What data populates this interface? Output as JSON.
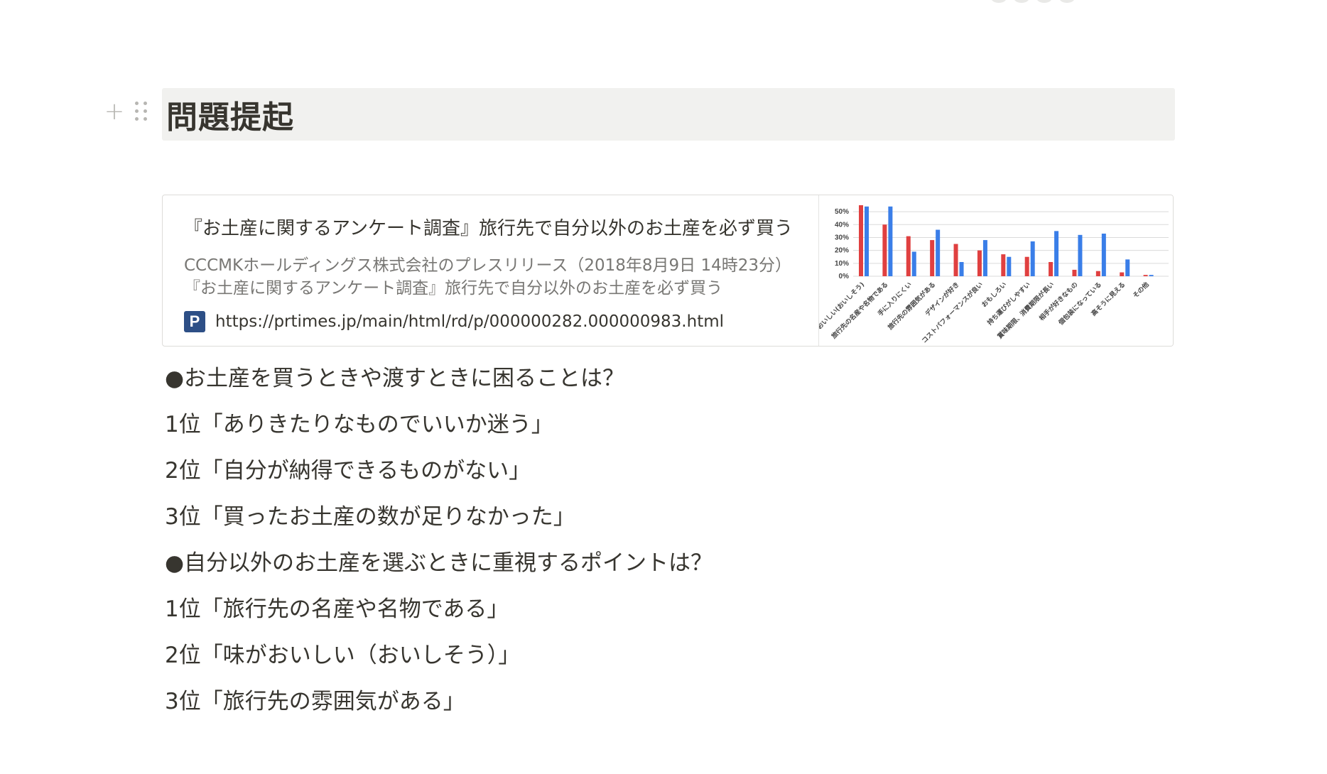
{
  "heading": {
    "text": "問題提起"
  },
  "bookmark": {
    "title": "『お土産に関するアンケート調査』旅行先で自分以外のお土産を必ず買う",
    "description": "CCCMKホールディングス株式会社のプレスリリース（2018年8月9日 14時23分）『お土産に関するアンケート調査』旅行先で自分以外のお土産を必ず買う",
    "url": "https://prtimes.jp/main/html/rd/p/000000282.000000983.html",
    "favicon_letter": "P",
    "favicon_icon": "prtimes-logo-icon"
  },
  "chart_data": {
    "type": "bar",
    "yticks": [
      "50%",
      "40%",
      "30%",
      "20%",
      "10%",
      "0%"
    ],
    "ylim": [
      0,
      55
    ],
    "categories": [
      "味がおいしい(おいしそう)",
      "旅行先の名産や名物である",
      "手に入りにくい",
      "旅行先の雰囲気がある",
      "デザインが好き",
      "コストパフォーマンスが良い",
      "おもしろい",
      "持ち運びがしやすい",
      "賞味期限、消費期限が長い",
      "相手が好きなもの",
      "個包装になっている",
      "高そうに見える",
      "その他"
    ],
    "series": [
      {
        "color": "#e04040",
        "values": [
          55,
          40,
          31,
          28,
          25,
          20,
          17,
          15,
          11,
          5,
          4,
          3,
          1
        ]
      },
      {
        "color": "#3a7ee8",
        "values": [
          54,
          54,
          19,
          36,
          11,
          28,
          15,
          27,
          35,
          32,
          33,
          13,
          1
        ]
      }
    ]
  },
  "content": {
    "lines": [
      "●お土産を買うときや渡すときに困ることは？",
      "1位「ありきたりなものでいいか迷う」",
      "2位「自分が納得できるものがない」",
      "3位「買ったお土産の数が足りなかった」",
      "●自分以外のお土産を選ぶときに重視するポイントは？",
      "1位「旅行先の名産や名物である」",
      "2位「味がおいしい（おいしそう）」",
      "3位「旅行先の雰囲気がある」"
    ]
  }
}
